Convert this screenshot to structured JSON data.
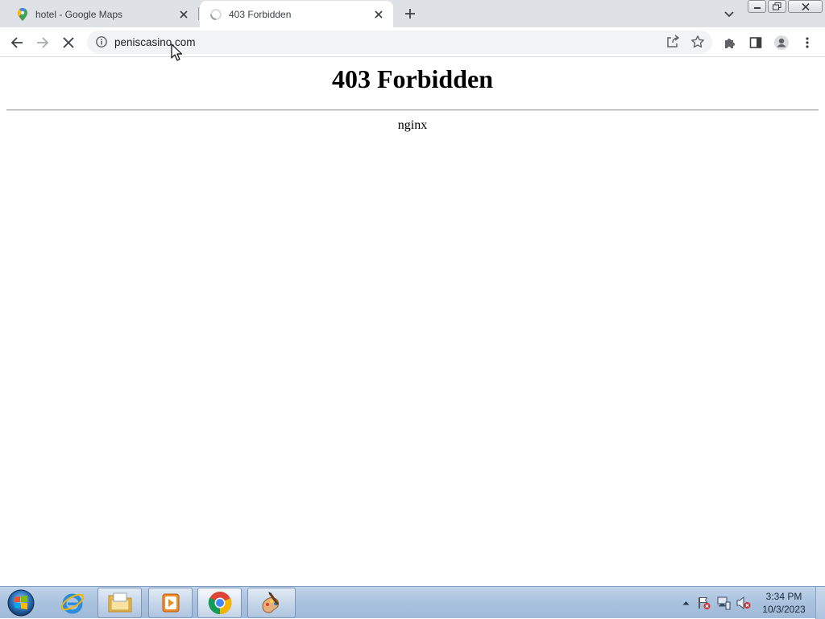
{
  "browser": {
    "tabs": [
      {
        "title": "hotel - Google Maps",
        "favicon": "google-maps-pin-icon",
        "active": false
      },
      {
        "title": "403 Forbidden",
        "favicon": "loading-spinner-icon",
        "active": true
      }
    ],
    "address": {
      "url": "peniscasino.com",
      "security_icon": "info-icon"
    },
    "toolbar_icons": [
      "back-arrow-icon",
      "forward-arrow-icon",
      "stop-loading-icon",
      "share-icon",
      "bookmark-star-icon",
      "extensions-puzzle-icon",
      "side-panel-icon",
      "profile-icon",
      "menu-kebab-icon"
    ]
  },
  "page": {
    "heading": "403 Forbidden",
    "server": "nginx"
  },
  "taskbar": {
    "apps": [
      "start-orb-icon",
      "internet-explorer-icon",
      "file-explorer-icon",
      "media-player-icon",
      "chrome-icon",
      "paint-app-icon"
    ],
    "clock": {
      "time": "3:34 PM",
      "date": "10/3/2023"
    }
  },
  "colors": {
    "tabstrip": "#dee1e6",
    "omnibox": "#f1f3f4",
    "taskbar": "#a9c2de"
  }
}
